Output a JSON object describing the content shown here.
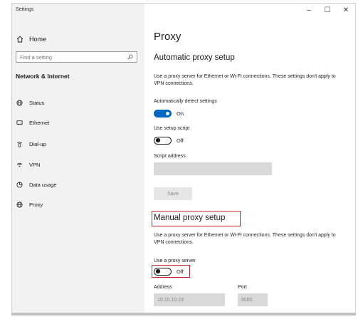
{
  "window": {
    "title": "Settings",
    "controls": {
      "minimize": "–",
      "maximize": "☐",
      "close": "✕"
    }
  },
  "sidebar": {
    "home_label": "Home",
    "search_placeholder": "Find a setting",
    "section_title": "Network & Internet",
    "items": [
      {
        "label": "Status",
        "icon": "globe-icon"
      },
      {
        "label": "Ethernet",
        "icon": "ethernet-icon"
      },
      {
        "label": "Dial-up",
        "icon": "dialup-icon"
      },
      {
        "label": "VPN",
        "icon": "vpn-icon"
      },
      {
        "label": "Data usage",
        "icon": "data-usage-icon"
      },
      {
        "label": "Proxy",
        "icon": "globe-icon"
      }
    ]
  },
  "main": {
    "title": "Proxy",
    "automatic": {
      "heading": "Automatic proxy setup",
      "description": "Use a proxy server for Ethernet or Wi-Fi connections. These settings don't apply to VPN connections.",
      "detect_label": "Automatically detect settings",
      "detect_state": "On",
      "script_label": "Use setup script",
      "script_state": "Off",
      "address_label": "Script address",
      "address_value": "",
      "save_label": "Save"
    },
    "manual": {
      "heading": "Manual proxy setup",
      "description": "Use a proxy server for Ethernet or Wi-Fi connections. These settings don't apply to VPN connections.",
      "use_proxy_label": "Use a proxy server",
      "use_proxy_state": "Off",
      "address_label": "Address",
      "address_value": "10.10.10.19",
      "port_label": "Port",
      "port_value": "8080"
    }
  },
  "colors": {
    "accent": "#0067c0",
    "highlight": "#c8232c",
    "sidebar_bg": "#f2f2f2"
  }
}
